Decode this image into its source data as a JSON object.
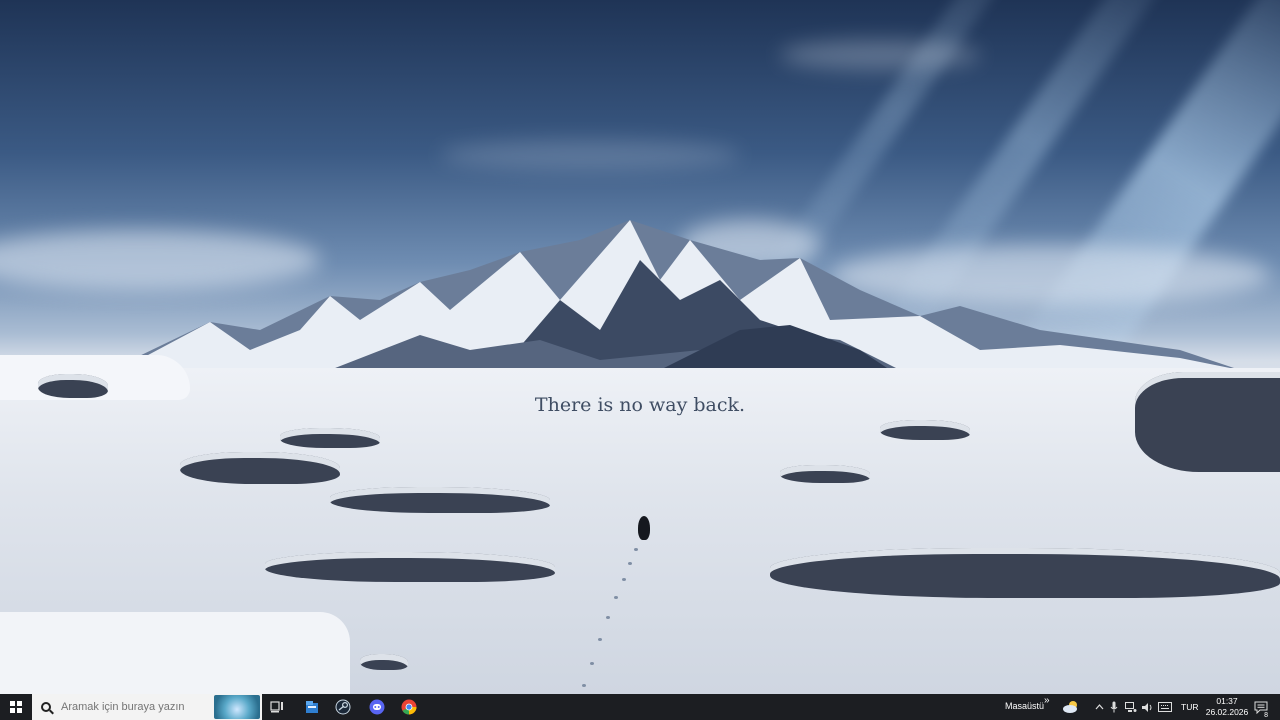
{
  "wallpaper": {
    "caption": "There is no way back."
  },
  "taskbar": {
    "search": {
      "placeholder": "Aramak için buraya yazın"
    },
    "pinned": [
      {
        "icon": "task-view-icon"
      },
      {
        "icon": "file-explorer-icon"
      },
      {
        "icon": "steam-icon"
      },
      {
        "icon": "discord-icon"
      },
      {
        "icon": "chrome-icon"
      }
    ],
    "desktop_label": "Masaüstü",
    "overflow_glyph": "»",
    "language": "TUR",
    "clock": {
      "time": "01:37",
      "date": "26.02.2026"
    },
    "notifications_count": "8"
  },
  "colors": {
    "taskbar_bg": "#1c1e22",
    "search_bg": "#f3f3f3",
    "discord": "#5865f2",
    "steam": "#1b2838",
    "chrome_red": "#ea4335",
    "chrome_yellow": "#fbbc05",
    "chrome_green": "#34a853"
  }
}
